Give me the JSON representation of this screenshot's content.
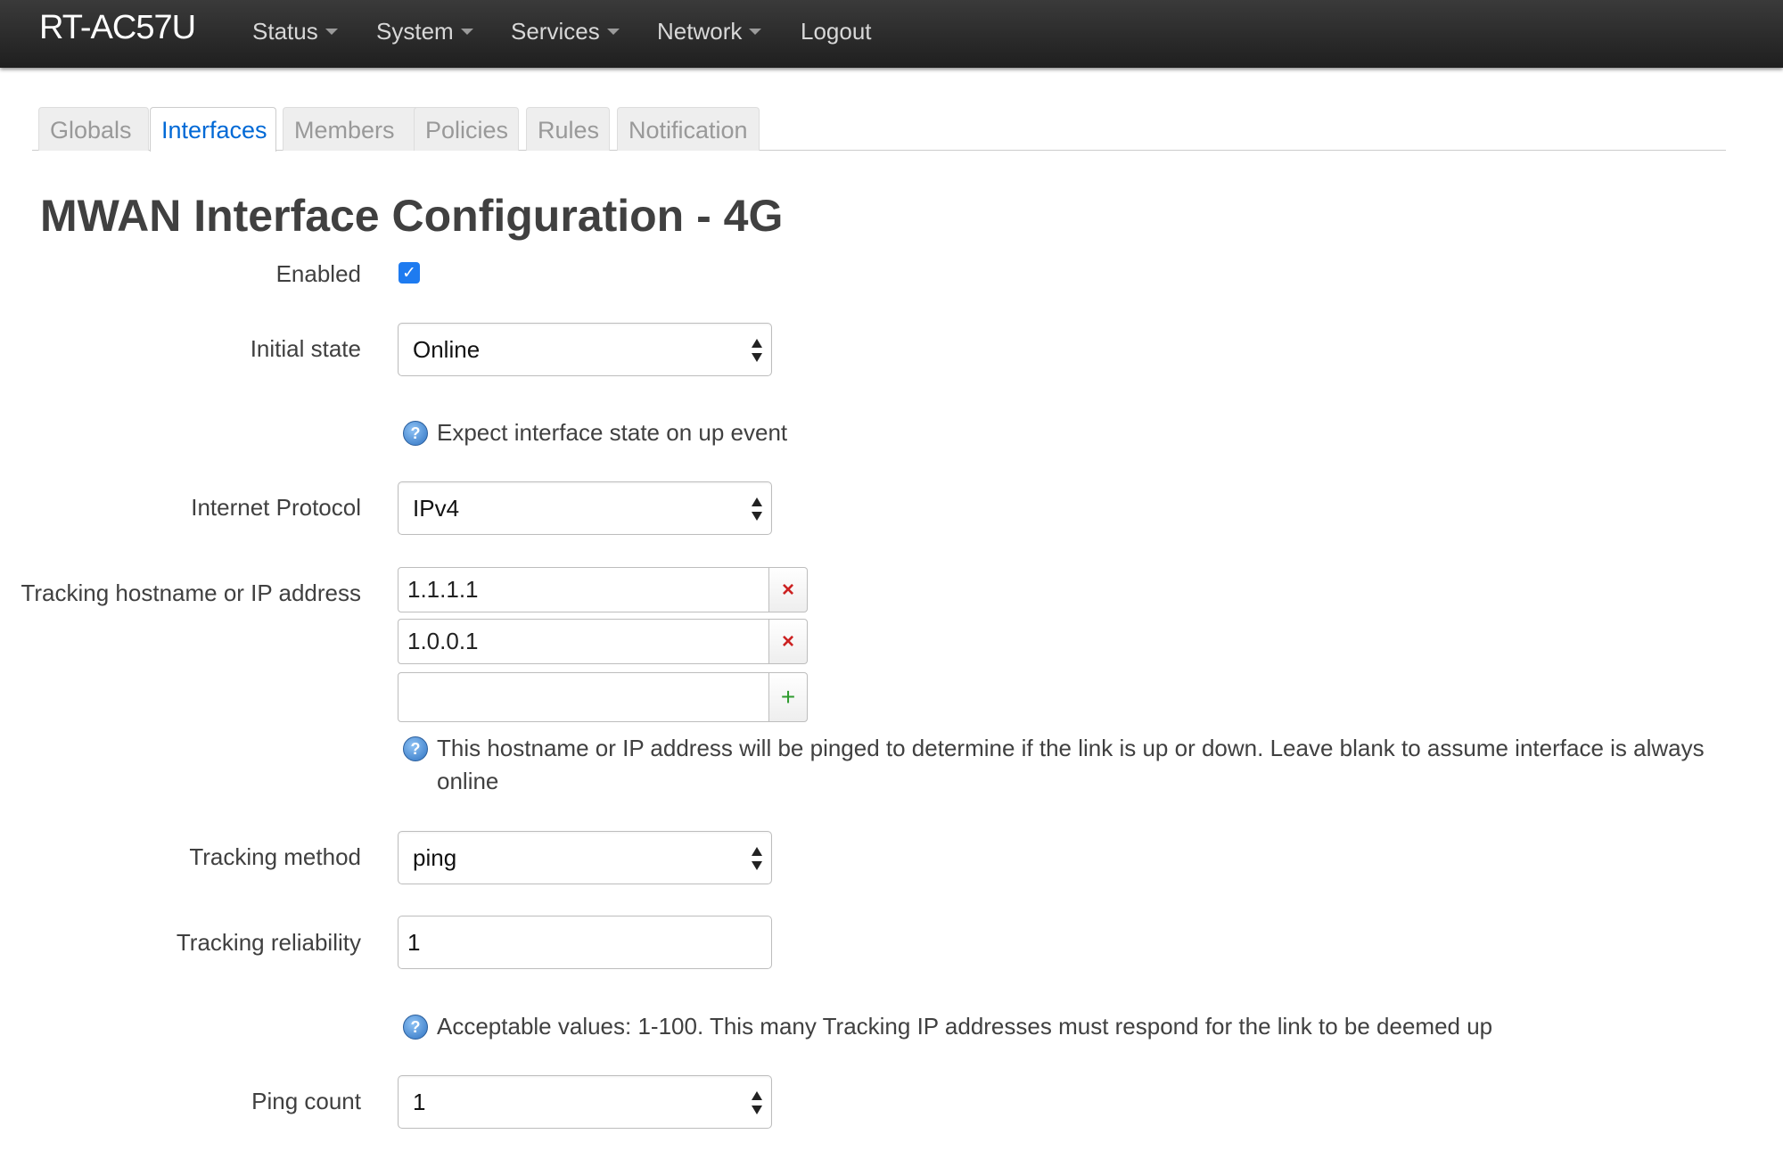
{
  "navbar": {
    "brand": "RT-AC57U",
    "items": [
      {
        "label": "Status",
        "dropdown": true
      },
      {
        "label": "System",
        "dropdown": true
      },
      {
        "label": "Services",
        "dropdown": true
      },
      {
        "label": "Network",
        "dropdown": true
      },
      {
        "label": "Logout",
        "dropdown": false
      }
    ]
  },
  "tabs": [
    {
      "label": "Globals",
      "active": false
    },
    {
      "label": "Interfaces",
      "active": true
    },
    {
      "label": "Members",
      "active": false
    },
    {
      "label": "Policies",
      "active": false
    },
    {
      "label": "Rules",
      "active": false
    },
    {
      "label": "Notification",
      "active": false
    }
  ],
  "page": {
    "title": "MWAN Interface Configuration - 4G"
  },
  "form": {
    "enabled": {
      "label": "Enabled",
      "checked": true
    },
    "initial_state": {
      "label": "Initial state",
      "value": "Online",
      "help": "Expect interface state on up event"
    },
    "internet_protocol": {
      "label": "Internet Protocol",
      "value": "IPv4"
    },
    "tracking_hosts": {
      "label": "Tracking hostname or IP address",
      "values": [
        "1.1.1.1",
        "1.0.0.1",
        ""
      ],
      "remove_glyph": "×",
      "add_glyph": "+",
      "help": "This hostname or IP address will be pinged to determine if the link is up or down. Leave blank to assume interface is always online"
    },
    "tracking_method": {
      "label": "Tracking method",
      "value": "ping"
    },
    "tracking_reliability": {
      "label": "Tracking reliability",
      "value": "1",
      "help": "Acceptable values: 1-100. This many Tracking IP addresses must respond for the link to be deemed up"
    },
    "ping_count": {
      "label": "Ping count",
      "value": "1"
    }
  },
  "icons": {
    "help": "help-question-icon",
    "check": "checkmark-icon"
  },
  "colors": {
    "navbar": "#222222",
    "active_tab": "#0069d6",
    "checkbox": "#1e7bf0",
    "remove": "#cc2222",
    "add": "#2e9b2e"
  }
}
